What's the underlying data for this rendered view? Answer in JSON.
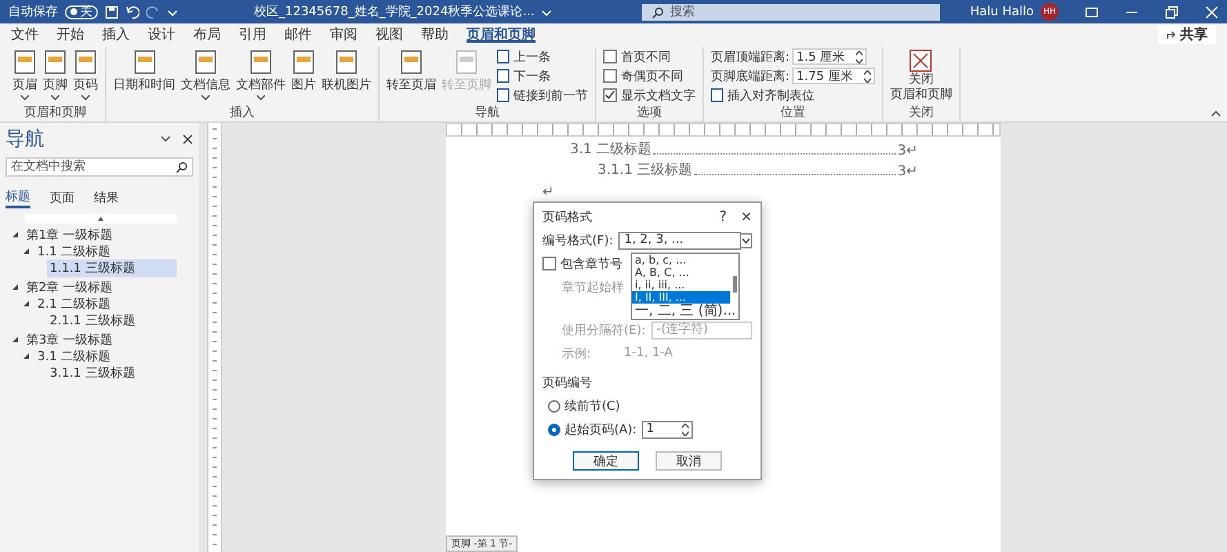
{
  "titlebar": {
    "autosave_label": "自动保存",
    "autosave": {
      "on": false,
      "label": "关"
    },
    "title": "校区_12345678_姓名_学院_2024秋季公选课论...",
    "search": {
      "placeholder": "搜索"
    },
    "user_name": "Halu Hallo",
    "avatar": "HH"
  },
  "tabs": [
    {
      "label": "文件",
      "selected": false
    },
    {
      "label": "开始",
      "selected": false
    },
    {
      "label": "插入",
      "selected": false
    },
    {
      "label": "设计",
      "selected": false
    },
    {
      "label": "布局",
      "selected": false
    },
    {
      "label": "引用",
      "selected": false
    },
    {
      "label": "邮件",
      "selected": false
    },
    {
      "label": "审阅",
      "selected": false
    },
    {
      "label": "视图",
      "selected": false
    },
    {
      "label": "帮助",
      "selected": false
    },
    {
      "label": "页眉和页脚",
      "selected": true
    }
  ],
  "share": "共享",
  "ribbon": [
    {
      "label": "页眉和页脚",
      "items": [
        {
          "kind": "large",
          "label": "页眉",
          "caret": true,
          "disabled": false
        },
        {
          "kind": "large",
          "label": "页脚",
          "caret": true,
          "disabled": false
        },
        {
          "kind": "large",
          "label": "页码",
          "caret": true,
          "disabled": false
        }
      ]
    },
    {
      "label": "插入",
      "items": [
        {
          "kind": "large",
          "label": "日期和时间",
          "caret": false,
          "disabled": false
        },
        {
          "kind": "large",
          "label": "文档信息",
          "caret": true,
          "disabled": false
        },
        {
          "kind": "large",
          "label": "文档部件",
          "caret": true,
          "disabled": false
        },
        {
          "kind": "large",
          "label": "图片",
          "caret": false,
          "disabled": false
        },
        {
          "kind": "large",
          "label": "联机图片",
          "caret": false,
          "disabled": false
        }
      ]
    },
    {
      "label": "导航",
      "items": [
        {
          "kind": "large",
          "label": "转至页眉",
          "caret": false,
          "disabled": false
        },
        {
          "kind": "large",
          "label": "转至页脚",
          "caret": false,
          "disabled": true
        },
        {
          "kind": "small",
          "label": "上一条",
          "disabled": false
        },
        {
          "kind": "small",
          "label": "下一条",
          "disabled": false
        },
        {
          "kind": "small",
          "label": "链接到前一节",
          "disabled": false
        }
      ]
    },
    {
      "label": "选项",
      "items": [
        {
          "kind": "check",
          "label": "首页不同",
          "checked": false
        },
        {
          "kind": "check",
          "label": "奇偶页不同",
          "checked": false
        },
        {
          "kind": "check",
          "label": "显示文档文字",
          "checked": true
        }
      ]
    },
    {
      "label": "位置",
      "items": [
        {
          "kind": "spin",
          "label": "页眉顶端距离:",
          "value": "1.5 厘米"
        },
        {
          "kind": "spin",
          "label": "页脚底端距离:",
          "value": "1.75 厘米"
        },
        {
          "kind": "small",
          "label": "插入对齐制表位",
          "disabled": false
        }
      ]
    },
    {
      "label": "关闭",
      "items": [
        {
          "kind": "close",
          "label_lines": [
            "关闭",
            "页眉和页脚"
          ]
        }
      ]
    }
  ],
  "nav": {
    "title": "导航",
    "search": {
      "placeholder": "在文档中搜索"
    },
    "tabs": [
      {
        "label": "标题",
        "selected": true
      },
      {
        "label": "页面",
        "selected": false
      },
      {
        "label": "结果",
        "selected": false
      }
    ],
    "tree": [
      {
        "label": "第1章 一级标题",
        "expanded": true,
        "selected": false,
        "children": [
          {
            "label": "1.1 二级标题",
            "expanded": true,
            "selected": false,
            "children": [
              {
                "label": "1.1.1 三级标题",
                "selected": true
              }
            ]
          }
        ]
      },
      {
        "label": "第2章 一级标题",
        "expanded": true,
        "selected": false,
        "children": [
          {
            "label": "2.1 二级标题",
            "expanded": true,
            "selected": false,
            "children": [
              {
                "label": "2.1.1 三级标题",
                "selected": false
              }
            ]
          }
        ]
      },
      {
        "label": "第3章 一级标题",
        "expanded": true,
        "selected": false,
        "children": [
          {
            "label": "3.1 二级标题",
            "expanded": true,
            "selected": false,
            "children": [
              {
                "label": "3.1.1 三级标题",
                "selected": false
              }
            ]
          }
        ]
      }
    ]
  },
  "document": {
    "toc": [
      {
        "kind": "level2",
        "text": "3.1 二级标题",
        "page": "3↵"
      },
      {
        "kind": "level3",
        "text": "3.1.1 三级标题",
        "page": "3↵"
      },
      {
        "kind": "empty",
        "text": "↵"
      }
    ],
    "footer_tag": "页脚 -第 1 节-"
  },
  "dialog": {
    "title": "页码格式",
    "help": "?",
    "close": "×",
    "format_label": "编号格式(F):",
    "format_value": "1, 2, 3, ...",
    "options": [
      {
        "label": "a, b, c, ...",
        "selected": false
      },
      {
        "label": "A, B, C, ...",
        "selected": false
      },
      {
        "label": "i, ii, iii, ...",
        "selected": false
      },
      {
        "label": "I, II, III, ...",
        "selected": true
      },
      {
        "label": "一, 二, 三 (简)...",
        "selected": false
      }
    ],
    "include_chapter": {
      "label": "包含章节号",
      "checked": false
    },
    "chapter_style_label": "章节起始样",
    "separator_label": "使用分隔符(E):",
    "separator_value": "-(连字符)",
    "example_label": "示例:",
    "example_value": "1-1, 1-A",
    "numbering_label": "页码编号",
    "radios": [
      {
        "label": "续前节(C)",
        "selected": false
      },
      {
        "label": "起始页码(A):",
        "selected": true
      }
    ],
    "start_value": "1",
    "ok": "确定",
    "cancel": "取消"
  }
}
